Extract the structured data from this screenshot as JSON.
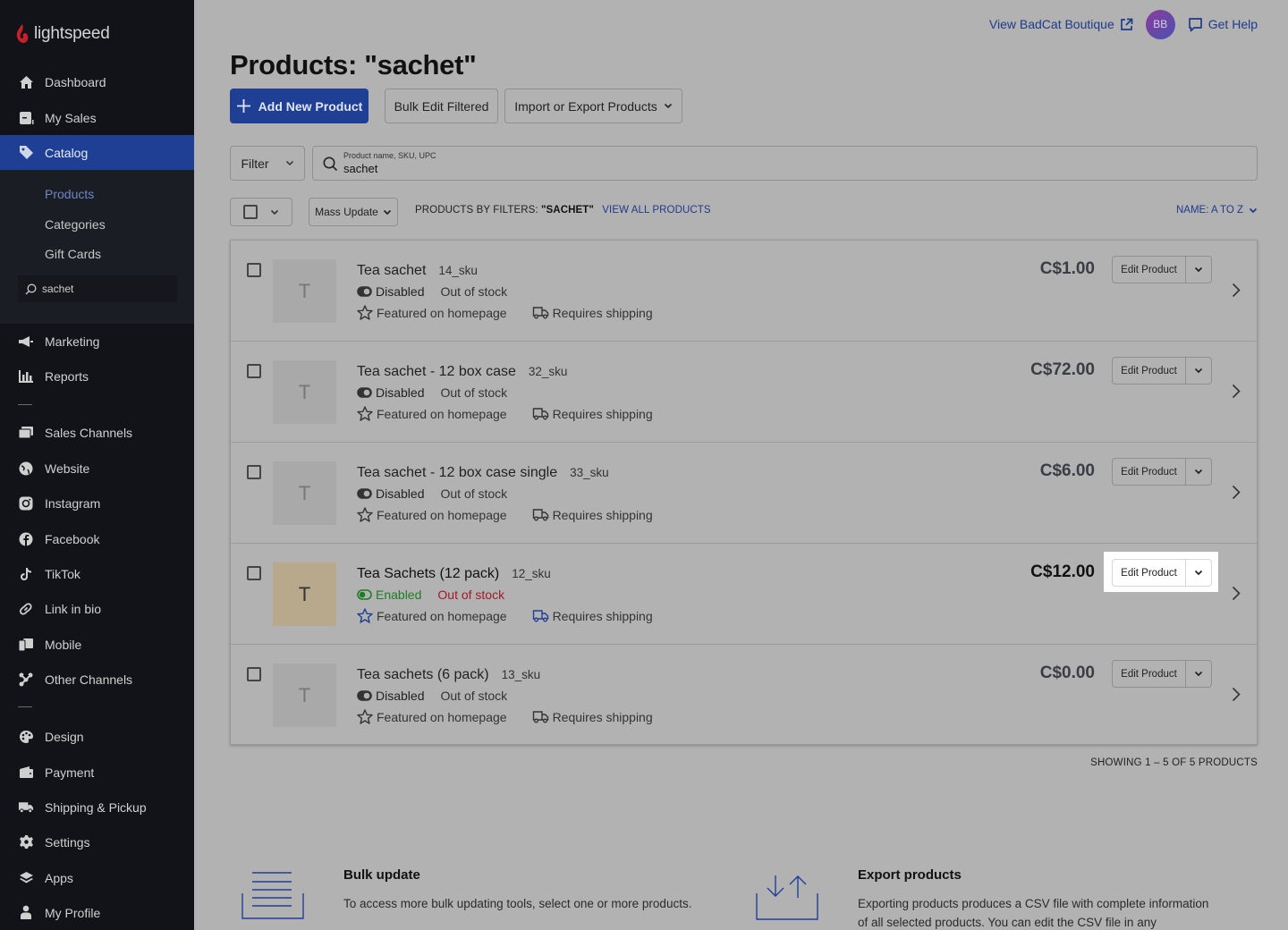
{
  "app": {
    "brand": "lightspeed",
    "accent_color": "#1f3f94",
    "brand_color": "#c8202a"
  },
  "sidebar": {
    "items": [
      {
        "label": "Dashboard",
        "icon": "home-icon"
      },
      {
        "label": "My Sales",
        "icon": "receipt-icon"
      },
      {
        "label": "Catalog",
        "icon": "tag-icon",
        "active": true
      },
      {
        "label": "Marketing",
        "icon": "megaphone-icon"
      },
      {
        "label": "Reports",
        "icon": "bar-chart-icon"
      },
      {
        "label": "Sales Channels",
        "icon": "channels-icon"
      },
      {
        "label": "Website",
        "icon": "globe-icon"
      },
      {
        "label": "Instagram",
        "icon": "instagram-icon"
      },
      {
        "label": "Facebook",
        "icon": "facebook-icon"
      },
      {
        "label": "TikTok",
        "icon": "tiktok-icon"
      },
      {
        "label": "Link in bio",
        "icon": "link-icon"
      },
      {
        "label": "Mobile",
        "icon": "mobile-icon"
      },
      {
        "label": "Other Channels",
        "icon": "share-nodes-icon"
      },
      {
        "label": "Design",
        "icon": "palette-icon"
      },
      {
        "label": "Payment",
        "icon": "wallet-icon"
      },
      {
        "label": "Shipping & Pickup",
        "icon": "truck-icon"
      },
      {
        "label": "Settings",
        "icon": "gear-icon"
      },
      {
        "label": "Apps",
        "icon": "layers-icon"
      },
      {
        "label": "My Profile",
        "icon": "user-icon"
      }
    ],
    "catalog_sub": [
      {
        "label": "Products",
        "active": true
      },
      {
        "label": "Categories"
      },
      {
        "label": "Gift Cards"
      }
    ],
    "search_value": "sachet"
  },
  "topbar": {
    "view_store": "View BadCat Boutique",
    "avatar_initials": "BB",
    "help": "Get Help"
  },
  "page": {
    "title": "Products: \"sachet\"",
    "add_button": "Add New Product",
    "bulk_edit_button": "Bulk Edit Filtered",
    "import_export_button": "Import or Export Products",
    "filter_button": "Filter",
    "search_label": "Product name, SKU, UPC",
    "search_value": "sachet",
    "mass_update": "Mass Update",
    "filter_prefix": "PRODUCTS BY FILTERS:",
    "filter_term": "\"SACHET\"",
    "view_all": "VIEW ALL PRODUCTS",
    "sort": "NAME: A TO Z",
    "showing": "SHOWING 1 – 5 OF 5 PRODUCTS"
  },
  "products": [
    {
      "initial": "T",
      "name": "Tea sachet",
      "sku": "14_sku",
      "status": "Disabled",
      "stock": "Out of stock",
      "featured": "Featured on homepage",
      "shipping": "Requires shipping",
      "price": "C$1.00",
      "edit": "Edit Product",
      "enabled": false
    },
    {
      "initial": "T",
      "name": "Tea sachet - 12 box case",
      "sku": "32_sku",
      "status": "Disabled",
      "stock": "Out of stock",
      "featured": "Featured on homepage",
      "shipping": "Requires shipping",
      "price": "C$72.00",
      "edit": "Edit Product",
      "enabled": false
    },
    {
      "initial": "T",
      "name": "Tea sachet - 12 box case single",
      "sku": "33_sku",
      "status": "Disabled",
      "stock": "Out of stock",
      "featured": "Featured on homepage",
      "shipping": "Requires shipping",
      "price": "C$6.00",
      "edit": "Edit Product",
      "enabled": false
    },
    {
      "initial": "T",
      "name": "Tea Sachets (12 pack)",
      "sku": "12_sku",
      "status": "Enabled",
      "stock": "Out of stock",
      "featured": "Featured on homepage",
      "shipping": "Requires shipping",
      "price": "C$12.00",
      "edit": "Edit Product",
      "enabled": true,
      "highlighted": true
    },
    {
      "initial": "T",
      "name": "Tea sachets (6 pack)",
      "sku": "13_sku",
      "status": "Disabled",
      "stock": "Out of stock",
      "featured": "Featured on homepage",
      "shipping": "Requires shipping",
      "price": "C$0.00",
      "edit": "Edit Product",
      "enabled": false
    }
  ],
  "colors": {
    "enabled": "#1e7d24",
    "out_of_stock_enabled": "#a0192a",
    "link": "#1f3a8c"
  },
  "info": {
    "bulk_title": "Bulk update",
    "bulk_text": "To access more bulk updating tools, select one or more products.",
    "export_title": "Export products",
    "export_text_1": "Exporting products produces a CSV file with complete information",
    "export_text_2": "of all selected products. You can edit the CSV file in any"
  }
}
